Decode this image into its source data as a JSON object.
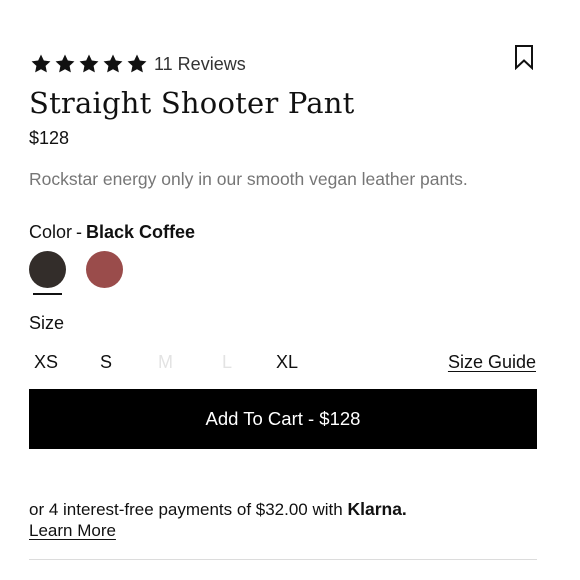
{
  "rating": {
    "stars": 5,
    "reviews_label": "11 Reviews"
  },
  "product": {
    "title": "Straight Shooter Pant",
    "price": "$128",
    "description": "Rockstar energy only in our smooth vegan leather pants."
  },
  "color": {
    "label": "Color",
    "separator": "-",
    "selected": "Black Coffee",
    "swatches": [
      {
        "name": "Black Coffee",
        "hex": "#332d2a",
        "selected": true
      },
      {
        "name": "",
        "hex": "#9a4c4b",
        "selected": false
      }
    ]
  },
  "size": {
    "label": "Size",
    "options": [
      {
        "label": "XS",
        "available": true
      },
      {
        "label": "S",
        "available": true
      },
      {
        "label": "M",
        "available": false
      },
      {
        "label": "L",
        "available": false
      },
      {
        "label": "XL",
        "available": true
      }
    ],
    "guide_label": "Size Guide"
  },
  "cart": {
    "button_label": "Add To Cart - $128"
  },
  "klarna": {
    "text": "or 4 interest-free payments of $32.00 with",
    "brand": "Klarna.",
    "learn_more": "Learn More"
  },
  "colors": {
    "text": "#111111",
    "muted": "#767676",
    "button_bg": "#000000",
    "disabled_size": "#e3e3e3"
  },
  "icons": {
    "star": "star-icon",
    "bookmark": "bookmark-icon"
  }
}
